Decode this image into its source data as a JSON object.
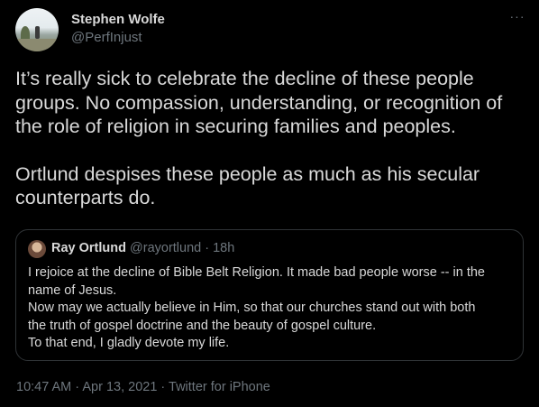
{
  "author": {
    "name": "Stephen Wolfe",
    "handle": "@PerfInjust"
  },
  "more_icon": "···",
  "tweet": {
    "paragraphs": [
      "It’s really sick to celebrate the decline of these people groups.  No compassion, understanding, or recognition of the role of religion in securing families and peoples.",
      "Ortlund despises these people as much as his secular counterparts do."
    ]
  },
  "quote": {
    "name": "Ray Ortlund",
    "meta": "@rayortlund · 18h",
    "lines": [
      "I rejoice at the decline of Bible Belt Religion. It made bad people worse -- in the",
      "name of Jesus.",
      "Now may we actually believe in Him, so that our churches stand out with both",
      "the truth of gospel doctrine and the beauty of gospel culture.",
      "To that end, I gladly devote my life."
    ]
  },
  "footer": {
    "time": "10:47 AM",
    "separator": " · ",
    "date": "Apr 13, 2021",
    "source": "Twitter for iPhone"
  }
}
